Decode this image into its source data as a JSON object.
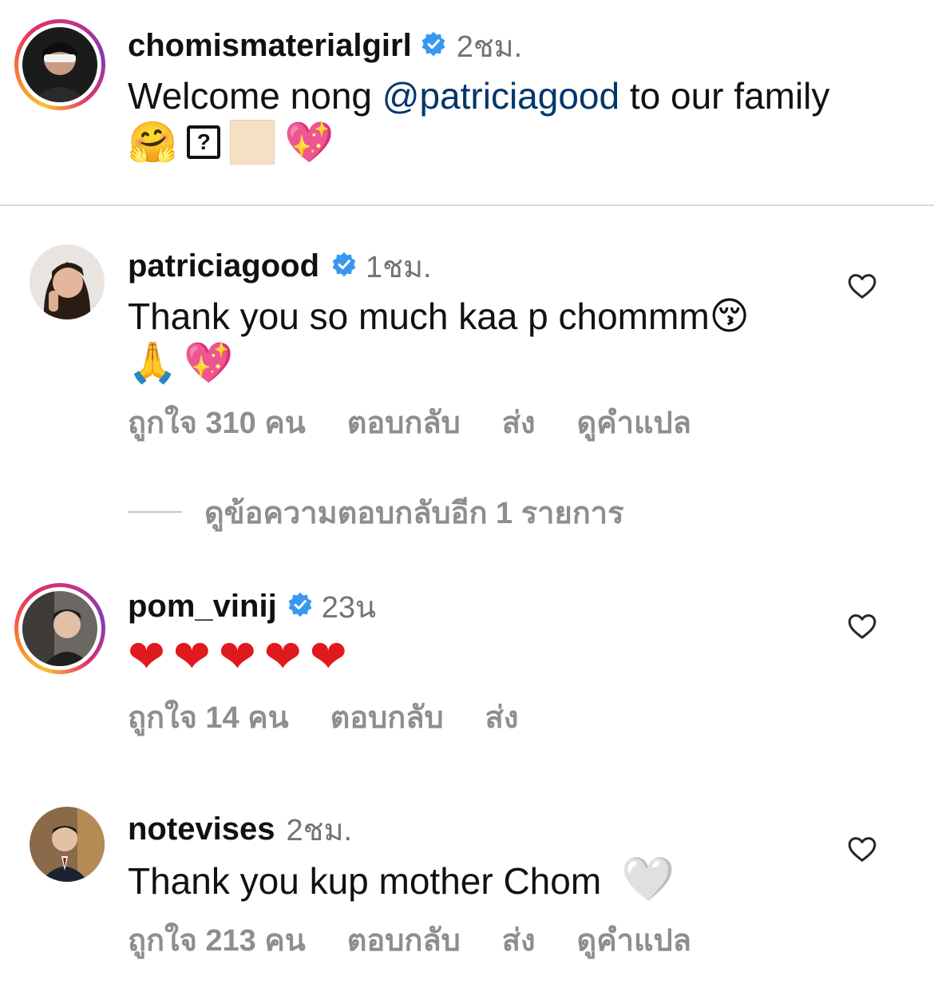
{
  "caption": {
    "username": "chomismaterialgirl",
    "time": "2ชม.",
    "text_before": "Welcome nong ",
    "mention": "@patriciagood",
    "text_after": " to our family",
    "emojis": [
      "🤗",
      "?",
      "",
      "💖"
    ]
  },
  "comments": [
    {
      "username": "patriciagood",
      "time": "1ชม.",
      "text_line1": "Thank you so much kaa p chommm",
      "emoji_line1": "😚",
      "emojis_line2": [
        "🙏",
        "💖"
      ],
      "likes": "ถูกใจ 310 คน",
      "reply": "ตอบกลับ",
      "send": "ส่ง",
      "translate": "ดูคำแปล",
      "view_replies": "ดูข้อความตอบกลับอีก 1 รายการ"
    },
    {
      "username": "pom_vinij",
      "time": "23น",
      "emojis": [
        "❤",
        "❤",
        "❤",
        "❤",
        "❤"
      ],
      "likes": "ถูกใจ 14 คน",
      "reply": "ตอบกลับ",
      "send": "ส่ง"
    },
    {
      "username": "notevises",
      "time": "2ชม.",
      "text": "Thank you kup mother Chom",
      "emoji": "🤍",
      "likes": "ถูกใจ 213 คน",
      "reply": "ตอบกลับ",
      "send": "ส่ง",
      "translate": "ดูคำแปล"
    }
  ],
  "colors": {
    "verified": "#3897f0",
    "mention": "#00376b",
    "secondary": "#8e8e8e"
  }
}
